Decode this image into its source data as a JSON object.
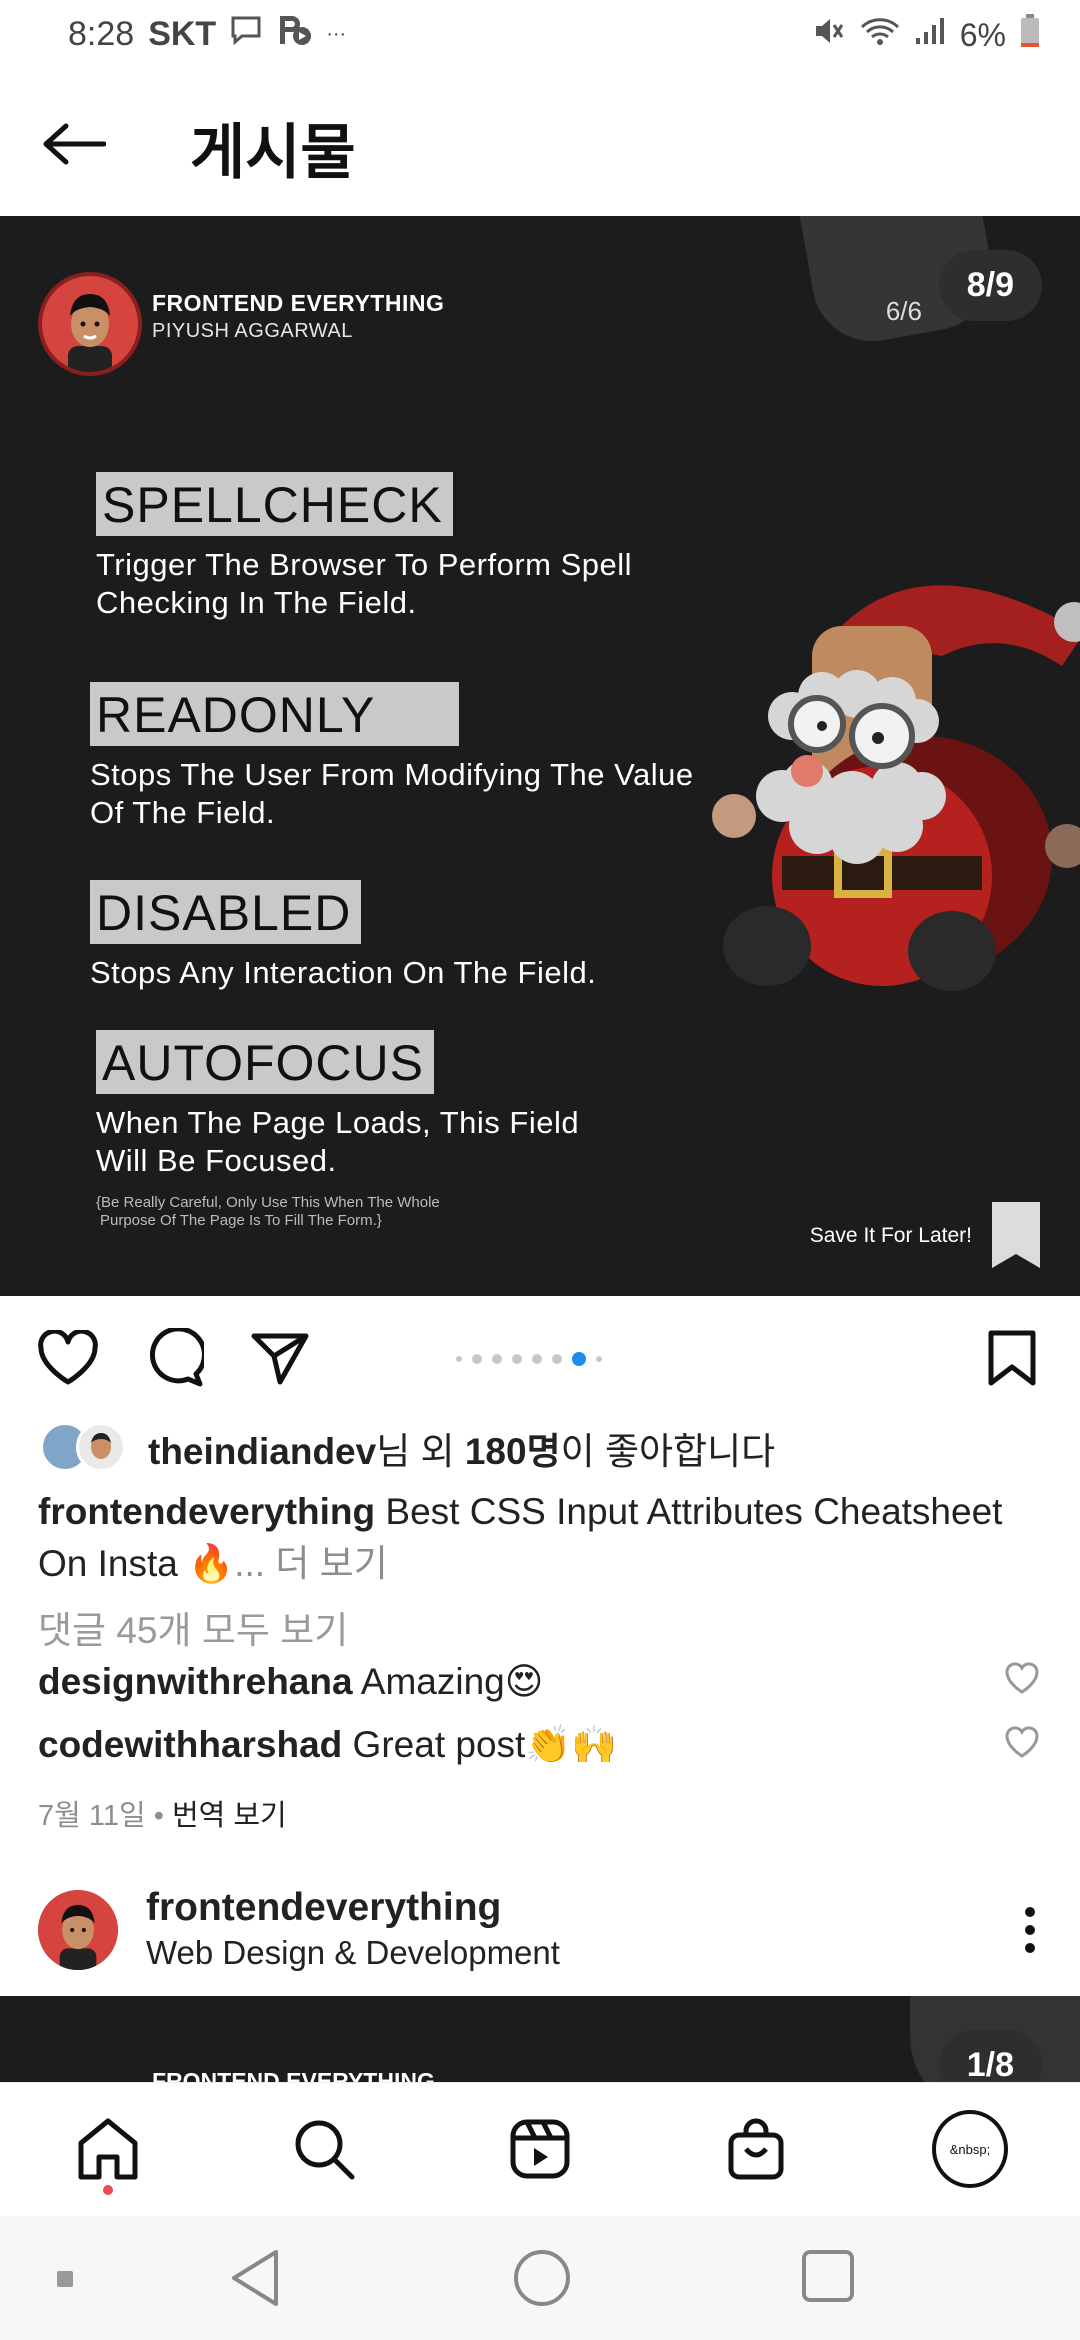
{
  "status_bar": {
    "time": "8:28",
    "carrier": "SKT",
    "overflow": "···",
    "battery": "6%",
    "icons": [
      "chat-icon",
      "parking-icon",
      "mute-icon",
      "wifi-icon",
      "signal-icon",
      "battery-icon"
    ]
  },
  "header": {
    "title": "게시물"
  },
  "post": {
    "slide_counter": "8/9",
    "inner_counter": "6/6",
    "brand": "FRONTEND EVERYTHING",
    "author": "PIYUSH AGGARWAL",
    "attributes": [
      {
        "title": "SPELLCHECK",
        "desc_line1": "Trigger The Browser To Perform Spell",
        "desc_line2": "Checking In The Field."
      },
      {
        "title": "READONLY",
        "desc_line1": "Stops The User From Modifying The Value",
        "desc_line2": "Of The Field."
      },
      {
        "title": "DISABLED",
        "desc_line1": "Stops Any Interaction On The Field.",
        "desc_line2": ""
      },
      {
        "title": "AUTOFOCUS",
        "desc_line1": "When The Page Loads, This Field",
        "desc_line2": "Will Be Focused."
      }
    ],
    "footnote_line1": "{Be Really Careful, Only Use This When The Whole",
    "footnote_line2": "Purpose Of The Page Is To Fill The Form.}",
    "save_later": "Save It For Later!"
  },
  "carousel": {
    "total_dots": 8,
    "active_index": 7
  },
  "likes": {
    "user": "theindiandev",
    "mid": "님 외 ",
    "count": "180명",
    "suffix": "이 좋아합니다"
  },
  "caption": {
    "username": "frontendeverything",
    "text": " Best CSS Input Attributes Cheatsheet On Insta ",
    "emoji": "🔥",
    "more": "... 더 보기"
  },
  "view_comments": "댓글 45개 모두 보기",
  "comments": [
    {
      "username": "designwithrehana",
      "text": " Amazing😍"
    },
    {
      "username": "codewithharshad",
      "text": " Great post👏🙌"
    }
  ],
  "meta": {
    "date": "7월 11일",
    "separator": " • ",
    "translate": "번역 보기"
  },
  "next_post": {
    "username": "frontendeverything",
    "subtitle": "Web Design & Development",
    "counter": "1/8",
    "brand": "FRONTEND EVERYTHING"
  },
  "bottom_nav": {
    "profile_placeholder": "&nbsp;",
    "items": [
      "home-icon",
      "search-icon",
      "reels-icon",
      "shop-icon",
      "profile-avatar"
    ]
  },
  "colors": {
    "accent_blue": "#1c8cf0",
    "notification_red": "#ed4956",
    "post_bg": "#1c1c1c"
  }
}
